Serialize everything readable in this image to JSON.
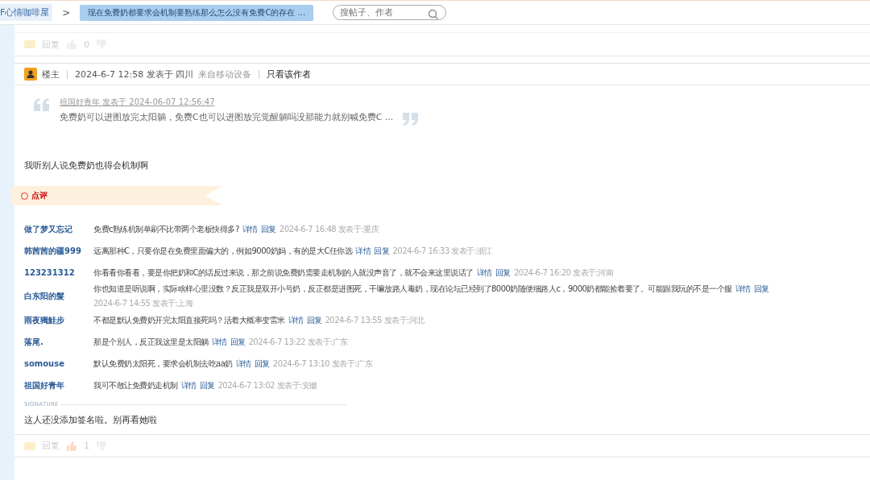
{
  "breadcrumb": {
    "forum": "F心情咖啡屋",
    "separator": ">",
    "thread": "现在免费奶都要求会机制要熟练那么怎么没有免费C的存在 ..."
  },
  "search": {
    "placeholder": "搜帖子、作者"
  },
  "prev_post_actions": {
    "reply": "回复",
    "likes": "0"
  },
  "post": {
    "role": "楼主",
    "time": "2024-6-7 12:58 发表于 四川",
    "device": "来自移动设备",
    "only_author": "只看该作者",
    "quote": {
      "meta": "祖国好青年 发表于 2024-06-07 12:56:47",
      "text": "免费奶可以进图放完太阳躺，免费C也可以进图放完觉醒躺吗没那能力就别喊免费C ..."
    },
    "body": "我听别人说免费奶也得会机制啊",
    "rate_label": "点评",
    "comments": [
      {
        "user": "做了梦又忘记",
        "text": "免费c熟练机制单刷不比带两个老板快得多?",
        "detail": "详情",
        "reply": "回复",
        "meta": "2024-6-7 16:48 发表于:重庆"
      },
      {
        "user": "韩茜茜的疆999",
        "text": "远离那种C，只要你是在免费里面偏大的，例如9000奶妈，有的是大C任你选",
        "detail": "详情",
        "reply": "回复",
        "meta": "2024-6-7 16:33 发表于:浙江"
      },
      {
        "user": "123231312",
        "text": "你看看你看看，要是你把奶和C的话反过来说，那之前说免费奶需要走机制的人就没声音了，就不会来这里说话了",
        "detail": "详情",
        "reply": "回复",
        "meta": "2024-6-7 16:20 发表于:河南"
      },
      {
        "user": "白东阳的髮",
        "text": "你也知道是听说啊，实际啥样心里没数？反正我是双开小号奶，反正都是进图死，干嘛放路人毒奶，现在论坛已经到了8000奶随便细路人c，9000奶都能捡着要了。可能跟我玩的不是一个服",
        "detail": "详情",
        "reply": "回复",
        "meta": "2024-6-7 14:55 发表于:上海"
      },
      {
        "user": "雨夜獨鮭步",
        "text": "不都是默认免费奶开完太阳直接死吗？活着大概率变雷米",
        "detail": "详情",
        "reply": "回复",
        "meta": "2024-6-7 13:55 发表于:河北"
      },
      {
        "user": "落尾.",
        "text": "那是个别人，反正我这里是太阳躺",
        "detail": "详情",
        "reply": "回复",
        "meta": "2024-6-7 13:22 发表于:广东"
      },
      {
        "user": "somouse",
        "text": "默认免费奶太阳死，要求会机制去吃aa奶",
        "detail": "详情",
        "reply": "回复",
        "meta": "2024-6-7 13:10 发表于:广东"
      },
      {
        "user": "祖国好青年",
        "text": "我可不敢让免费奶走机制",
        "detail": "详情",
        "reply": "回复",
        "meta": "2024-6-7 13:02 发表于:安徽"
      }
    ],
    "signature_label": "SIGNATURE",
    "signature": "这人还没添加签名啦。别再看她啦",
    "actions": {
      "reply": "回复",
      "likes": "1",
      "liked": true
    }
  }
}
